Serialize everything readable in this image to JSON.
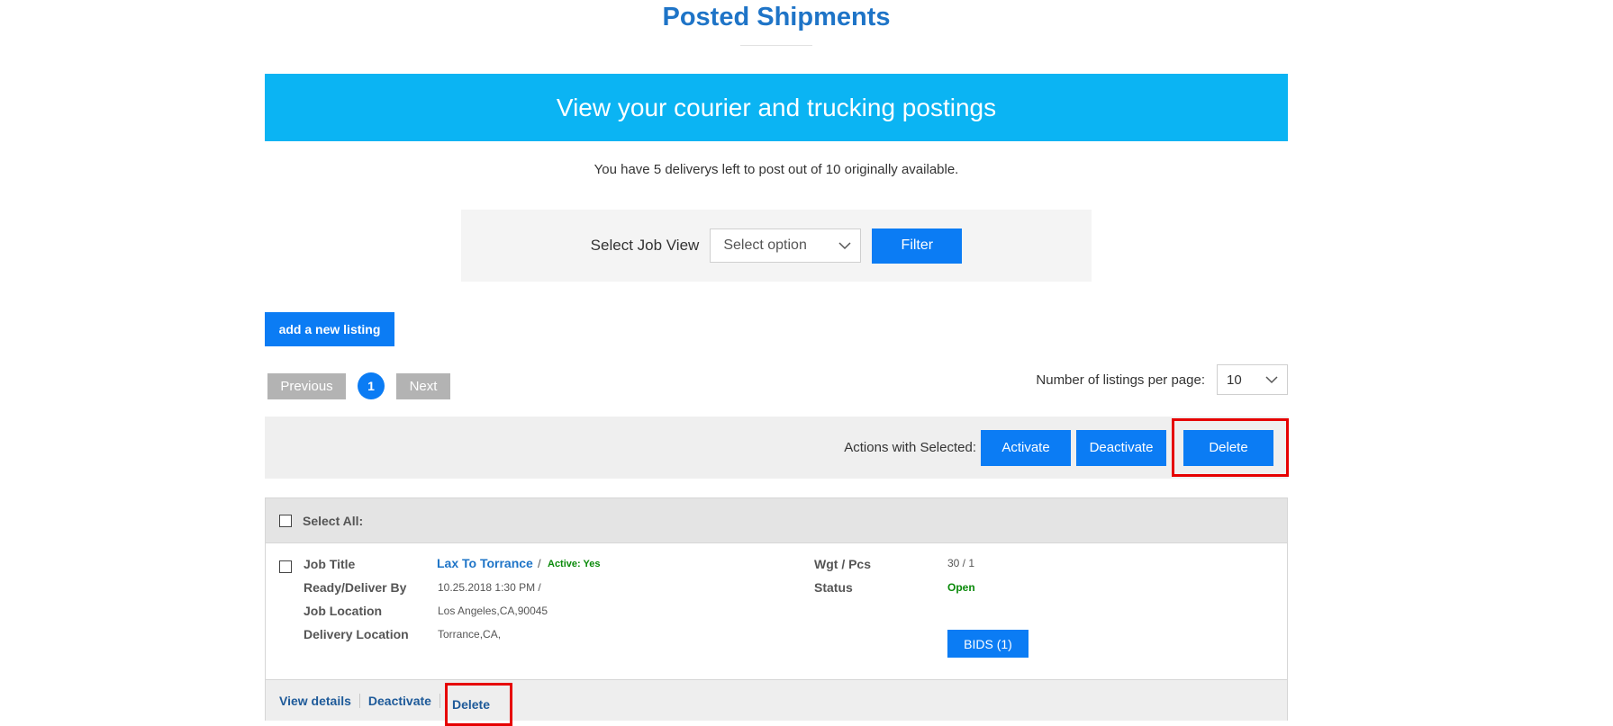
{
  "page": {
    "title": "Posted Shipments",
    "banner": "View your courier and trucking postings",
    "remaining_text": "You have 5 deliverys left to post out of 10 originally available."
  },
  "filter": {
    "label": "Select Job View",
    "select_value": "Select option",
    "button": "Filter"
  },
  "add_listing_button": "add a new listing",
  "pagination": {
    "previous": "Previous",
    "current_page": "1",
    "next": "Next",
    "per_page_label": "Number of listings per page:",
    "per_page_value": "10"
  },
  "actions": {
    "label": "Actions with Selected:",
    "activate": "Activate",
    "deactivate": "Deactivate",
    "delete": "Delete"
  },
  "listing": {
    "select_all_label": "Select All:",
    "items": [
      {
        "labels": {
          "job_title": "Job Title",
          "ready_deliver": "Ready/Deliver By",
          "job_location": "Job Location",
          "delivery_location": "Delivery Location",
          "wgt_pcs": "Wgt / Pcs",
          "status": "Status"
        },
        "title": "Lax To Torrance",
        "separator": "/",
        "active": "Active: Yes",
        "ready_deliver": "10.25.2018 1:30 PM /",
        "job_location": "Los Angeles,CA,90045",
        "delivery_location": "Torrance,CA,",
        "wgt_pcs": "30 / 1",
        "status": "Open",
        "bids_button": "BIDS (1)",
        "links": {
          "view_details": "View details",
          "deactivate": "Deactivate",
          "delete": "Delete"
        }
      }
    ]
  },
  "colors": {
    "title": "#1e74c7",
    "banner_bg": "#0bb4f3",
    "button_blue": "#0b7cf4",
    "button_gray": "#b3b3b3",
    "highlight_red": "#e60000",
    "status_green": "#0a8a0a"
  }
}
